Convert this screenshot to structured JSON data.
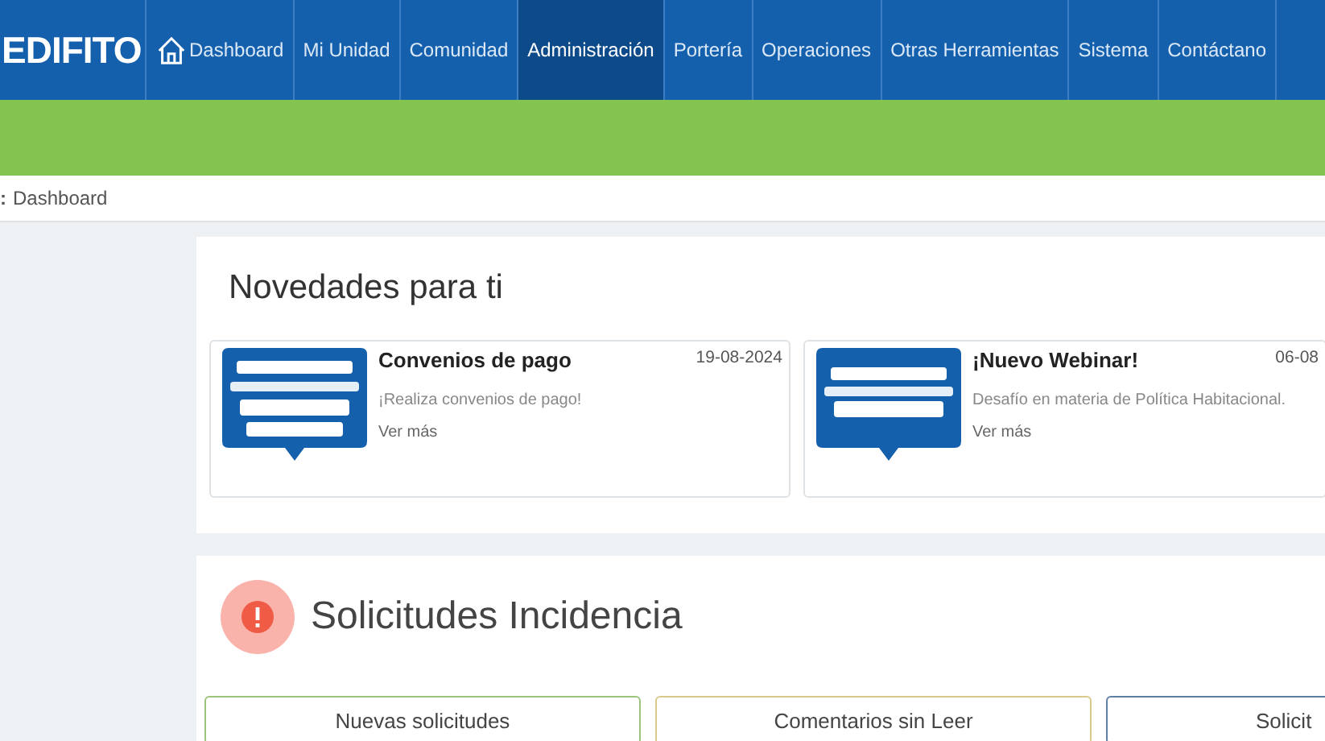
{
  "logo": "EDIFITO",
  "nav": [
    {
      "label": "Dashboard",
      "selected": false
    },
    {
      "label": "Mi Unidad",
      "selected": false
    },
    {
      "label": "Comunidad",
      "selected": false
    },
    {
      "label": "Administración",
      "selected": true
    },
    {
      "label": "Portería",
      "selected": false
    },
    {
      "label": "Operaciones",
      "selected": false
    },
    {
      "label": "Otras Herramientas",
      "selected": false
    },
    {
      "label": "Sistema",
      "selected": false
    },
    {
      "label": "Contáctano",
      "selected": false
    }
  ],
  "breadcrumb": {
    "prefix": ":",
    "current": "Dashboard"
  },
  "news": {
    "title": "Novedades para ti",
    "items": [
      {
        "title": "Convenios de pago",
        "date": "19-08-2024",
        "text": "¡Realiza convenios de pago!",
        "link": "Ver más",
        "kind": "picture"
      },
      {
        "title": "¡Nuevo Webinar!",
        "date": "06-08",
        "text": "Desafío en materia de Política Habitacional.",
        "link": "Ver más",
        "kind": "picture"
      }
    ]
  },
  "incidents": {
    "title": "Solicitudes Incidencia",
    "tabs": [
      {
        "label": "Nuevas solicitudes",
        "color": "#9cc47a"
      },
      {
        "label": "Comentarios sin Leer",
        "color": "#d9c98a"
      },
      {
        "label": "Solicit",
        "color": "#5f7fa6"
      }
    ]
  }
}
